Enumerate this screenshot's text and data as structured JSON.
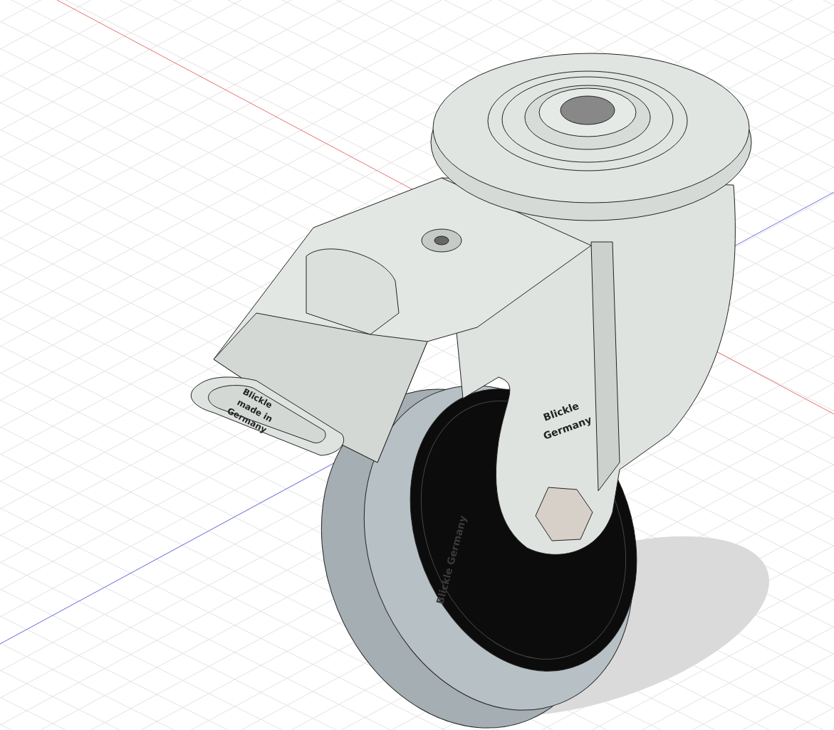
{
  "viewport": {
    "grid": true,
    "axes": [
      {
        "kind": "x",
        "color": "#e87070"
      },
      {
        "kind": "y",
        "color": "#7070e8"
      }
    ]
  },
  "model": {
    "markings": [
      {
        "kind": "fork",
        "text": "Blickle"
      },
      {
        "kind": "fork",
        "text": "Germany"
      },
      {
        "kind": "pedal",
        "text": "Blickle"
      },
      {
        "kind": "pedal",
        "text": "made in"
      },
      {
        "kind": "pedal",
        "text": "Germany"
      },
      {
        "kind": "rim",
        "text": "Blickle Germany"
      }
    ]
  }
}
